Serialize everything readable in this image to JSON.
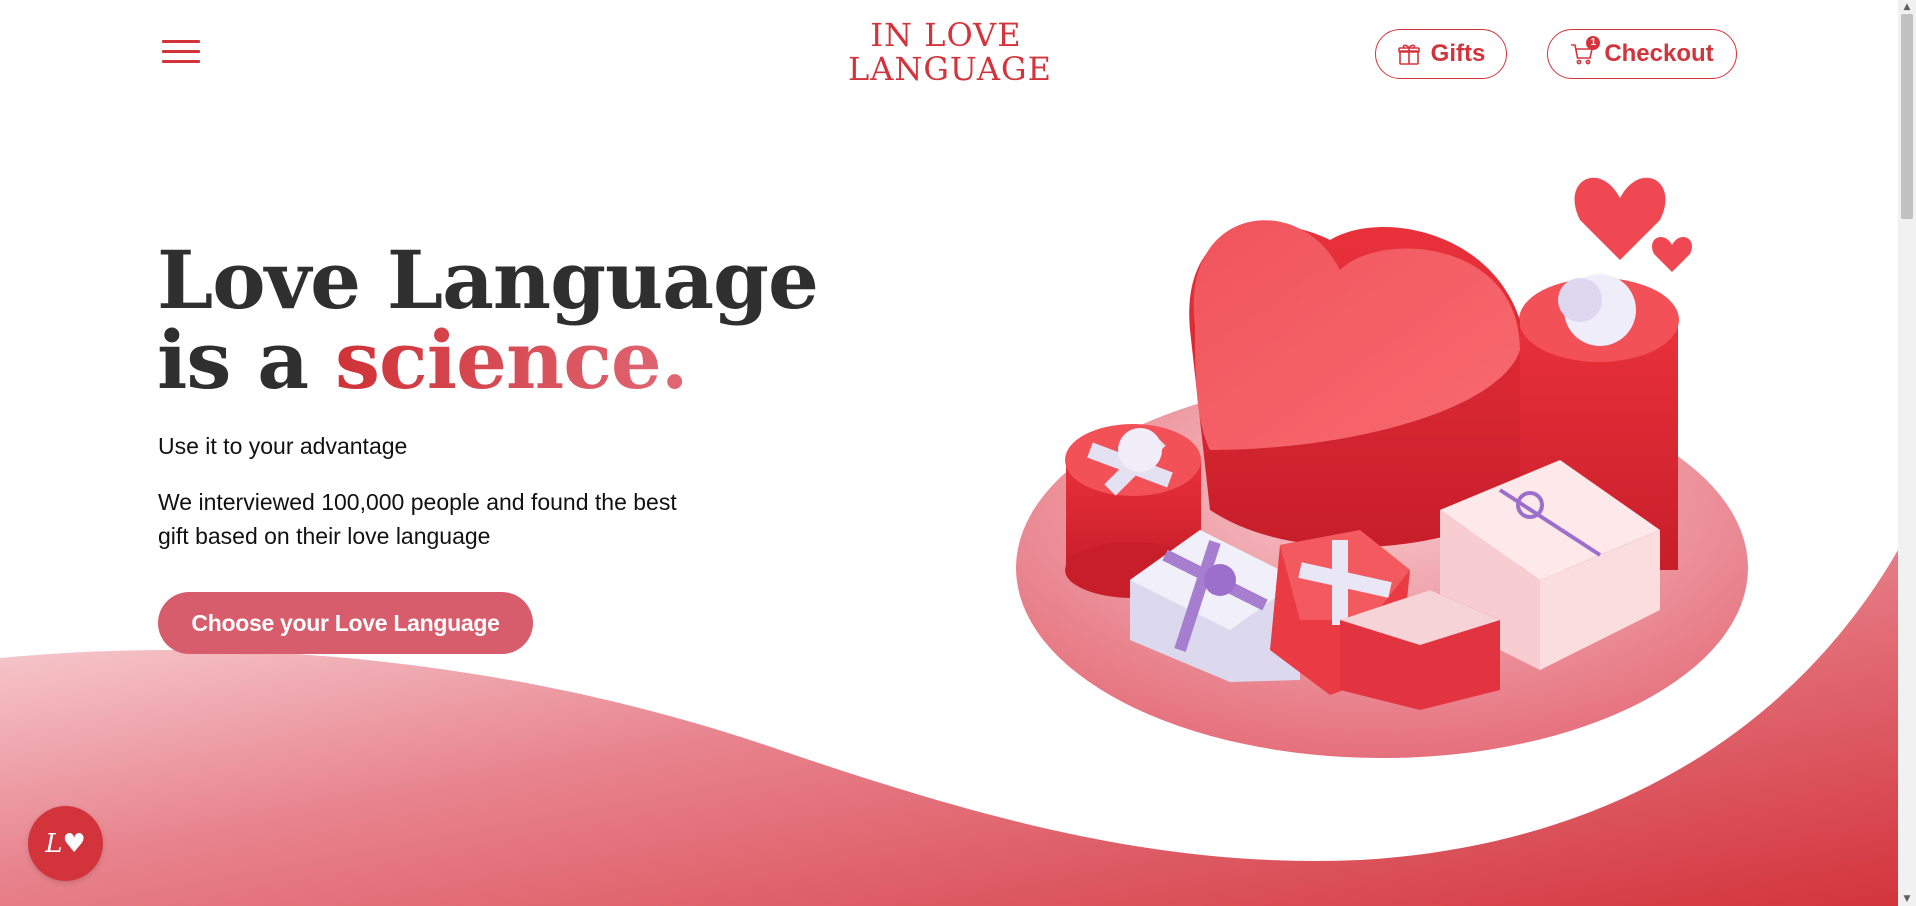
{
  "header": {
    "logo_line1": "IN LOVE",
    "logo_line2": "LANGUAGE",
    "gifts_label": "Gifts",
    "checkout_label": "Checkout",
    "cart_count": "1",
    "menu_icon": "hamburger-icon",
    "gifts_icon": "gift-icon",
    "checkout_icon": "cart-icon"
  },
  "hero": {
    "title_line1": "Love Language",
    "title_line2_prefix": "is a",
    "title_line2_accent": "science.",
    "subtitle": "Use it to your advantage",
    "description": "We interviewed 100,000 people and found the best gift based on their love language",
    "cta_label": "Choose your Love Language"
  },
  "chat": {
    "icon": "love-language-chat-icon",
    "glyph": "L♥"
  },
  "colors": {
    "brand": "#d3343c",
    "cta": "#d85d6c",
    "title": "#2f2f2f"
  }
}
